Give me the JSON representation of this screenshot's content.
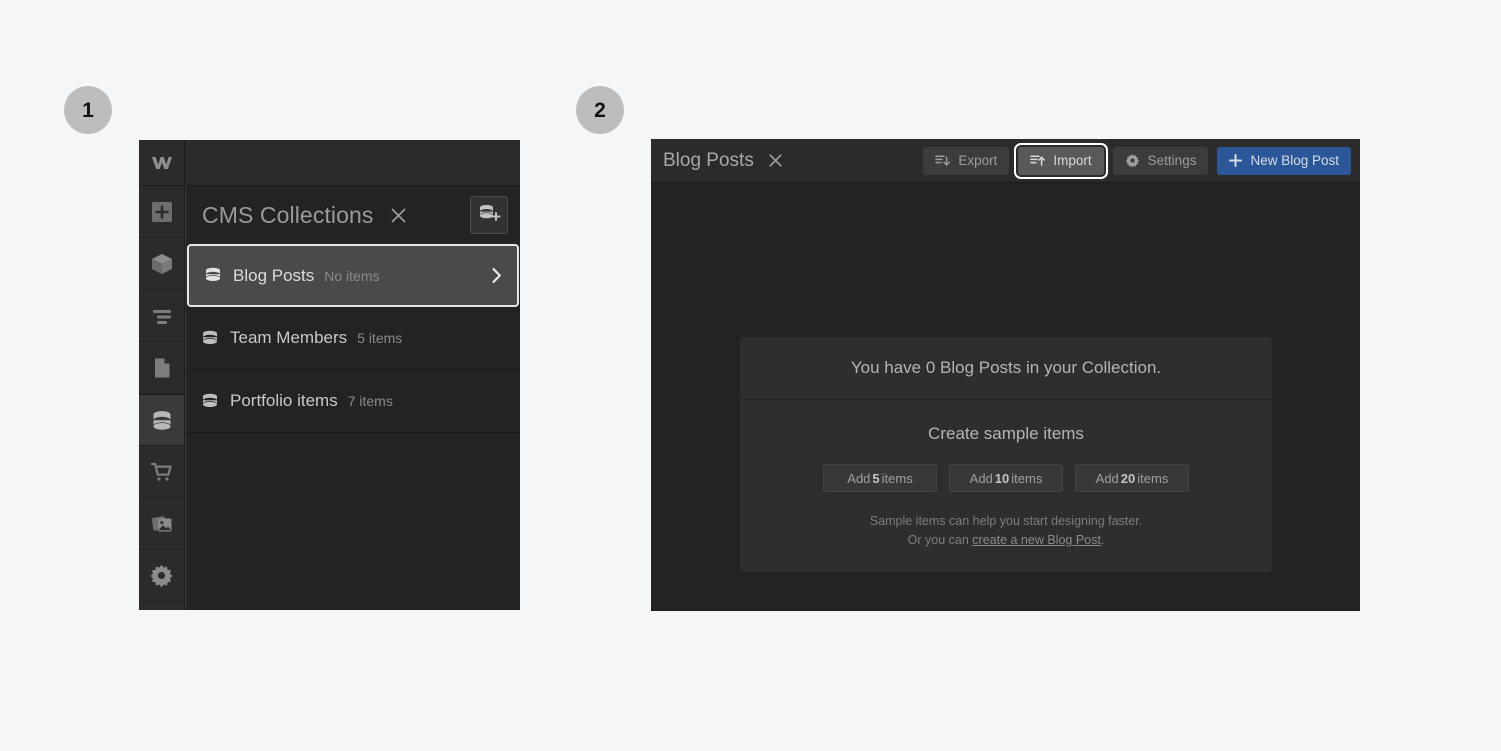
{
  "steps": [
    {
      "label": "1"
    },
    {
      "label": "2"
    }
  ],
  "colors": {
    "page_bg": "#f4f6f8",
    "panel_bg": "#232323",
    "toolbar_bg": "#2b2b2b",
    "card_bg": "#2e2e2e",
    "primary_blue": "#2b5697",
    "badge_gray": "#bdbdbd",
    "selected_row": "#4a4a4a",
    "focus_ring": "#ffffff"
  },
  "panel1": {
    "rail": {
      "logo": "webflow-logo-icon",
      "items": [
        {
          "icon": "add-element-icon",
          "name": "add-panel",
          "active": false
        },
        {
          "icon": "components-cube-icon",
          "name": "components-panel",
          "active": false
        },
        {
          "icon": "navigator-layers-icon",
          "name": "navigator-panel",
          "active": false
        },
        {
          "icon": "pages-document-icon",
          "name": "pages-panel",
          "active": false
        },
        {
          "icon": "cms-database-icon",
          "name": "cms-panel",
          "active": true
        },
        {
          "icon": "ecommerce-cart-icon",
          "name": "ecommerce-panel",
          "active": false
        },
        {
          "icon": "assets-images-icon",
          "name": "assets-panel",
          "active": false
        },
        {
          "icon": "settings-gear-icon",
          "name": "settings-panel",
          "active": false
        }
      ]
    },
    "cms": {
      "title": "CMS Collections",
      "close_icon": "close-x-icon",
      "add_collection_icon": "database-plus-icon",
      "collections": [
        {
          "name": "Blog Posts",
          "count": "No items",
          "selected": true,
          "icon": "database-icon",
          "chevron": "chevron-right-icon"
        },
        {
          "name": "Team Members",
          "count": "5 items",
          "selected": false,
          "icon": "database-icon"
        },
        {
          "name": "Portfolio items",
          "count": "7 items",
          "selected": false,
          "icon": "database-icon"
        }
      ]
    }
  },
  "panel2": {
    "tab": {
      "title": "Blog Posts",
      "close_icon": "close-x-icon"
    },
    "actions": [
      {
        "label": "Export",
        "icon": "export-down-icon",
        "style": "default"
      },
      {
        "label": "Import",
        "icon": "import-up-icon",
        "style": "focused"
      },
      {
        "label": "Settings",
        "icon": "gear-icon",
        "style": "default"
      },
      {
        "label": "New Blog Post",
        "icon": "plus-icon",
        "style": "primary"
      }
    ],
    "empty_state": {
      "headline": "You have 0 Blog Posts in your Collection.",
      "sub_headline": "Create sample items",
      "sample_buttons": [
        {
          "prefix": "Add ",
          "count": "5",
          "suffix": " items"
        },
        {
          "prefix": "Add ",
          "count": "10",
          "suffix": " items"
        },
        {
          "prefix": "Add ",
          "count": "20",
          "suffix": " items"
        }
      ],
      "note_line_1": "Sample items can help you start designing faster.",
      "note_line_2_prefix": "Or you can ",
      "note_link": "create a new Blog Post",
      "note_line_2_suffix": "."
    }
  }
}
